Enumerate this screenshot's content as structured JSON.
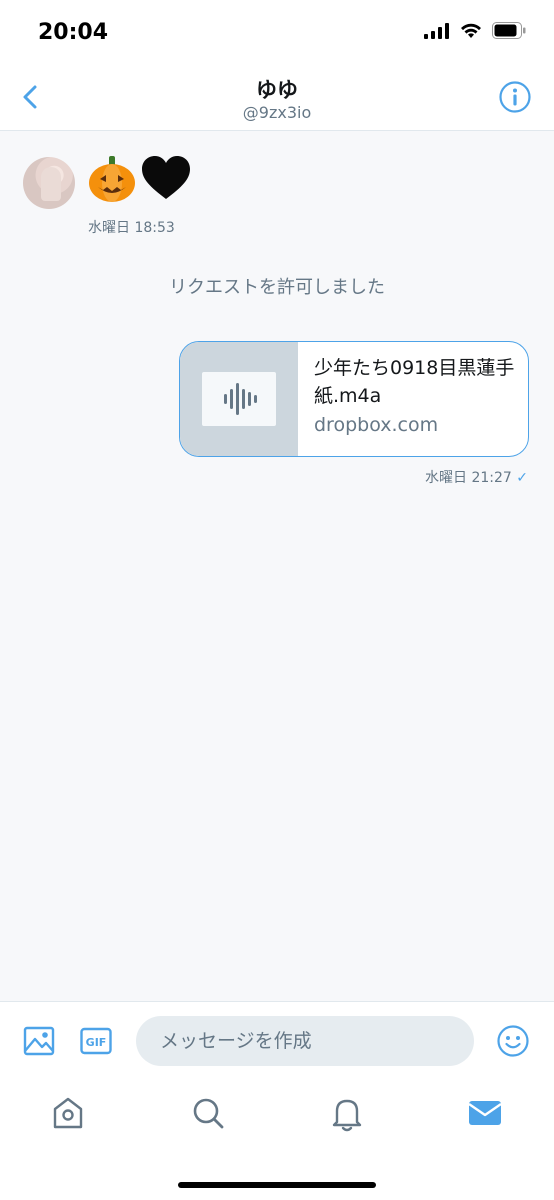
{
  "status": {
    "time": "20:04"
  },
  "header": {
    "name": "ゆゆ",
    "handle": "@9zx3io"
  },
  "messages": {
    "incoming": {
      "emojis": [
        "🎃",
        "🖤"
      ],
      "timestamp": "水曜日 18:53"
    },
    "system": "リクエストを許可しました",
    "outgoing": {
      "card_title": "少年たち0918目黒蓮手紙.m4a",
      "card_domain": "dropbox.com",
      "timestamp": "水曜日 21:27",
      "read_mark": "✓"
    }
  },
  "composer": {
    "placeholder": "メッセージを作成",
    "gif_label": "GIF"
  },
  "colors": {
    "accent": "#4da3e8",
    "muted": "#657786",
    "bubble_border": "#4da3e8"
  }
}
